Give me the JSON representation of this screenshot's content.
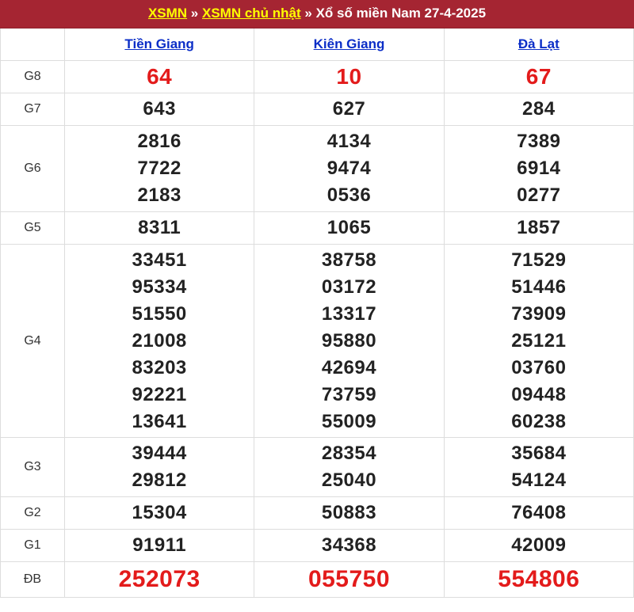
{
  "breadcrumb": {
    "item1": "XSMN",
    "sep1": " » ",
    "item2": "XSMN chủ nhật",
    "sep2": " » ",
    "title": "Xổ số miền Nam 27-4-2025"
  },
  "provinces": [
    "Tiền Giang",
    "Kiên Giang",
    "Đà Lạt"
  ],
  "prizes": [
    {
      "label": "G8",
      "values": [
        [
          "64"
        ],
        [
          "10"
        ],
        [
          "67"
        ]
      ]
    },
    {
      "label": "G7",
      "values": [
        [
          "643"
        ],
        [
          "627"
        ],
        [
          "284"
        ]
      ]
    },
    {
      "label": "G6",
      "values": [
        [
          "2816",
          "7722",
          "2183"
        ],
        [
          "4134",
          "9474",
          "0536"
        ],
        [
          "7389",
          "6914",
          "0277"
        ]
      ]
    },
    {
      "label": "G5",
      "values": [
        [
          "8311"
        ],
        [
          "1065"
        ],
        [
          "1857"
        ]
      ]
    },
    {
      "label": "G4",
      "values": [
        [
          "33451",
          "95334",
          "51550",
          "21008",
          "83203",
          "92221",
          "13641"
        ],
        [
          "38758",
          "03172",
          "13317",
          "95880",
          "42694",
          "73759",
          "55009"
        ],
        [
          "71529",
          "51446",
          "73909",
          "25121",
          "03760",
          "09448",
          "60238"
        ]
      ]
    },
    {
      "label": "G3",
      "values": [
        [
          "39444",
          "29812"
        ],
        [
          "28354",
          "25040"
        ],
        [
          "35684",
          "54124"
        ]
      ]
    },
    {
      "label": "G2",
      "values": [
        [
          "15304"
        ],
        [
          "50883"
        ],
        [
          "76408"
        ]
      ]
    },
    {
      "label": "G1",
      "values": [
        [
          "91911"
        ],
        [
          "34368"
        ],
        [
          "42009"
        ]
      ]
    },
    {
      "label": "ĐB",
      "values": [
        [
          "252073"
        ],
        [
          "055750"
        ],
        [
          "554806"
        ]
      ]
    }
  ],
  "colors": {
    "header_bg": "#a52532",
    "breadcrumb_link": "#ffff00",
    "province_link": "#0b2ec7",
    "highlight_number": "#e31b1b"
  }
}
